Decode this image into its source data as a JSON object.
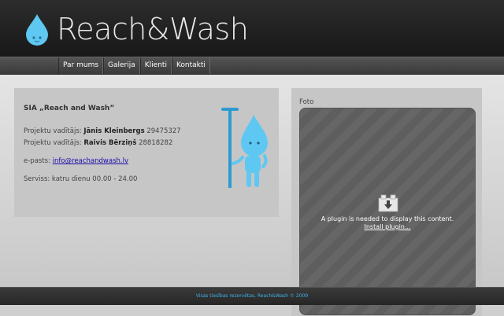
{
  "header": {
    "logo_text": "Reach&Wash"
  },
  "nav": {
    "items": [
      "Par mums",
      "Galerija",
      "Klienti",
      "Kontakti"
    ]
  },
  "info": {
    "title": "SIA „Reach and Wash”",
    "manager1_label": "Projektu vadītājs:",
    "manager1_name": "Jānis Kleinbergs",
    "manager1_phone": "29475327",
    "manager2_label": "Projektu vadītājs:",
    "manager2_name": "Raivis Bērziņš",
    "manager2_phone": "28818282",
    "email_label": "e-pasts:",
    "email": "info@reachandwash.lv",
    "service": "Serviss: katru dienu 00.00 - 24.00"
  },
  "foto": {
    "label": "Foto",
    "plugin_message": "A plugin is needed to display this content.",
    "plugin_link": "Install plugin..."
  },
  "footer": {
    "text": "Visas tiesības rezervētas, Reach&Wash © 2009"
  },
  "colors": {
    "brand_blue": "#5ec8f2",
    "footer_text": "#3fb3e6",
    "header_bg": "#1f1f1f"
  },
  "icons": {
    "logo": "water-drop-icon",
    "mascot": "water-drop-mascot",
    "plugin": "plugin-download-icon"
  }
}
